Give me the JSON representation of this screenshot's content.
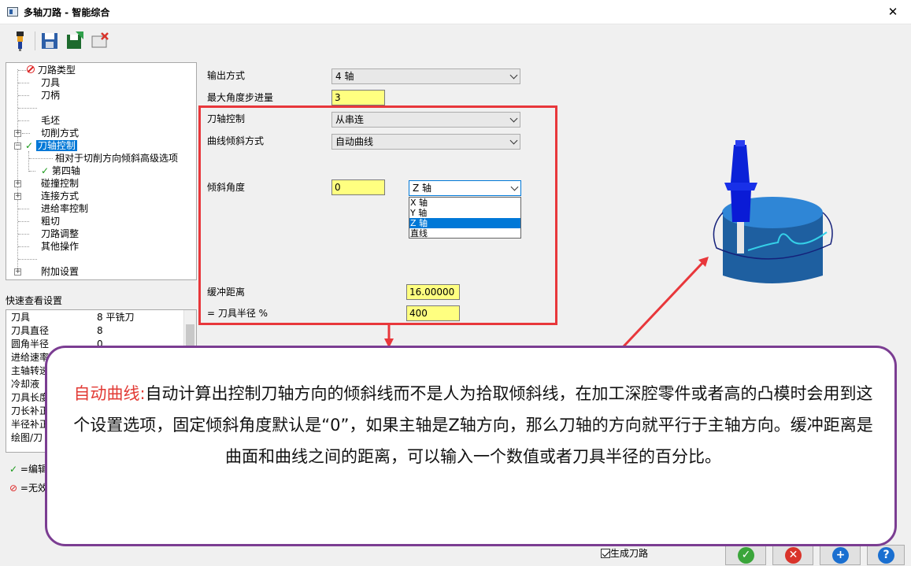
{
  "window": {
    "title": "多轴刀路 - 智能综合",
    "close_glyph": "✕"
  },
  "toolbar": {
    "icons": [
      "tool-holder-icon",
      "save-icon",
      "save-export-icon",
      "delete-icon"
    ]
  },
  "tree": {
    "items": [
      {
        "label": "刀路类型",
        "status": "invalid"
      },
      {
        "label": "刀具"
      },
      {
        "label": "刀柄"
      },
      {
        "label": ""
      },
      {
        "label": "毛坯"
      },
      {
        "label": "切削方式",
        "expander": "+"
      },
      {
        "label": "刀轴控制",
        "expander": "-",
        "status": "edited",
        "selected": true
      },
      {
        "label": "相对于切削方向倾斜高级选项"
      },
      {
        "label": "第四轴",
        "status": "edited"
      },
      {
        "label": "碰撞控制",
        "expander": "+"
      },
      {
        "label": "连接方式",
        "expander": "+"
      },
      {
        "label": "进给率控制"
      },
      {
        "label": "粗切"
      },
      {
        "label": "刀路调整"
      },
      {
        "label": "其他操作"
      },
      {
        "label": ""
      },
      {
        "label": "附加设置",
        "expander": "+"
      }
    ]
  },
  "quick_settings": {
    "title": "快速查看设置",
    "rows": [
      {
        "k": "刀具",
        "v": "8 平铣刀"
      },
      {
        "k": "刀具直径",
        "v": "8"
      },
      {
        "k": "圆角半径",
        "v": "0"
      },
      {
        "k": "进给速率",
        "v": ""
      },
      {
        "k": "主轴转速",
        "v": ""
      },
      {
        "k": "冷却液",
        "v": ""
      },
      {
        "k": "刀具长度",
        "v": ""
      },
      {
        "k": "刀长补正",
        "v": ""
      },
      {
        "k": "半径补正",
        "v": ""
      },
      {
        "k": "绘图/刀",
        "v": ""
      }
    ],
    "legend": [
      {
        "symbol": "✓",
        "label": "=编辑"
      },
      {
        "symbol": "⊘",
        "label": "=无效"
      }
    ]
  },
  "form": {
    "output_mode": {
      "label": "输出方式",
      "value": "4 轴"
    },
    "max_angle_step": {
      "label": "最大角度步进量",
      "value": "3"
    },
    "tool_axis_control": {
      "label": "刀轴控制",
      "value": "从串连"
    },
    "curve_tilt_mode": {
      "label": "曲线倾斜方式",
      "value": "自动曲线"
    },
    "tilt_angle": {
      "label": "倾斜角度",
      "value": "0"
    },
    "axis_select": {
      "value": "Z 轴",
      "options": [
        "X 轴",
        "Y 轴",
        "Z 轴",
        "直线"
      ],
      "selected_index": 2
    },
    "buffer_distance": {
      "label": "缓冲距离",
      "value": "16.00000"
    },
    "tool_radius_pct": {
      "label": "= 刀具半径 %",
      "value": "400"
    }
  },
  "footer": {
    "generate_path": "生成刀路",
    "buttons": [
      {
        "name": "ok-button",
        "glyph": "✓",
        "color": "#3aa53a"
      },
      {
        "name": "cancel-button",
        "glyph": "✕",
        "color": "#d9342b"
      },
      {
        "name": "add-button",
        "glyph": "+",
        "color": "#1a6fd0"
      },
      {
        "name": "help-button",
        "glyph": "?",
        "color": "#1a6fd0"
      }
    ]
  },
  "callout": {
    "highlight": "自动曲线:",
    "text": "自动计算出控制刀轴方向的倾斜线而不是人为拾取倾斜线，在加工深腔零件或者高的凸模时会用到这个设置选项，固定倾斜角度默认是“0”，如果主轴是Z轴方向，那么刀轴的方向就平行于主轴方向。缓冲距离是曲面和曲线之间的距离，可以输入一个数值或者刀具半径的百分比。"
  },
  "colors": {
    "highlight_box": "#e8373b",
    "callout_border": "#7b3d92",
    "field_bg": "#ffff80",
    "selection": "#0078d7"
  }
}
